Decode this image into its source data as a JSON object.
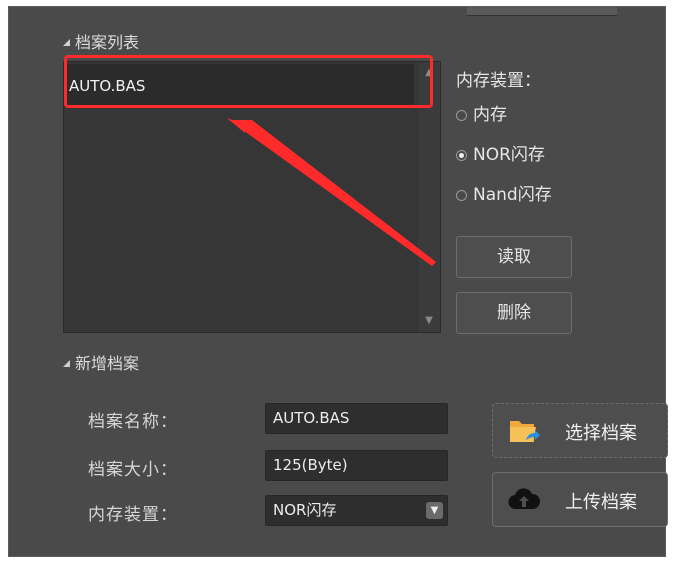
{
  "file_list": {
    "section_title": "档案列表",
    "items": [
      "AUTO.BAS"
    ],
    "scroll_up_glyph": "▲",
    "scroll_down_glyph": "▼"
  },
  "storage": {
    "label": "内存装置：",
    "options": [
      "内存",
      "NOR闪存",
      "Nand闪存"
    ],
    "selected": "NOR闪存"
  },
  "actions": {
    "read_label": "读取",
    "delete_label": "删除"
  },
  "new_file": {
    "section_title": "新增档案",
    "name_label": "档案名称：",
    "name_value": "AUTO.BAS",
    "size_label": "档案大小：",
    "size_value": "125(Byte)",
    "storage_label": "内存装置：",
    "storage_value": "NOR闪存",
    "select_file_label": "选择档案",
    "upload_label": "上传档案"
  },
  "colors": {
    "annotation": "#ff2a2a",
    "folder_icon": "#f2a93b",
    "folder_arrow": "#2b8fe0",
    "cloud_icon": "#111111"
  },
  "icons": {
    "section_toggle": "triangle-down-icon",
    "select_file": "folder-open-icon",
    "upload": "cloud-upload-icon",
    "dropdown": "chevron-down-icon"
  }
}
